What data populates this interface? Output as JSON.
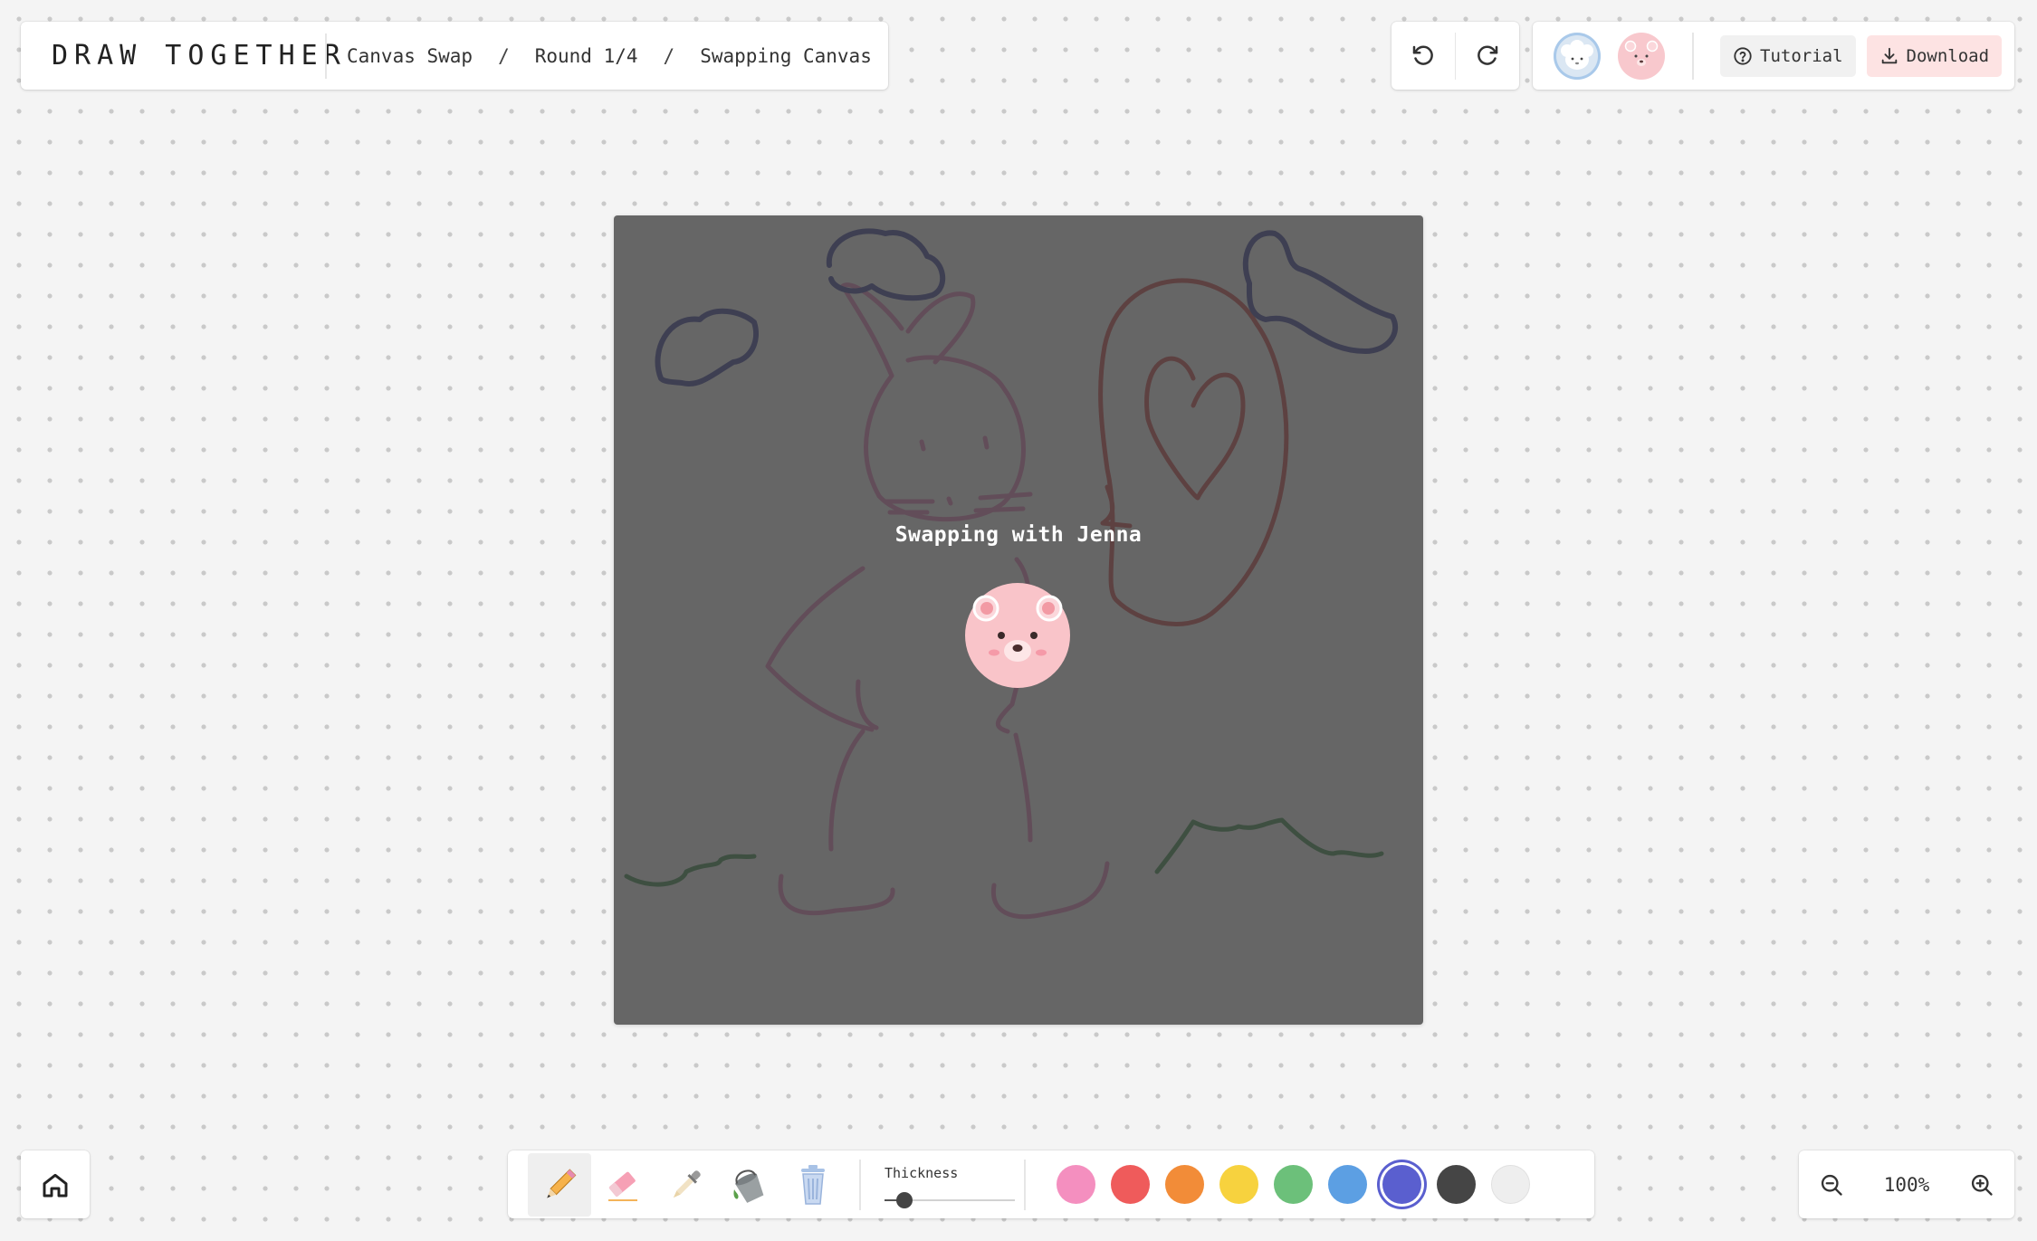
{
  "header": {
    "app_title": "DRAW TOGETHER",
    "breadcrumb": [
      "Canvas Swap",
      "Round 1/4",
      "Swapping Canvas"
    ],
    "breadcrumb_separator": "/"
  },
  "history": {
    "undo_icon": "undo-icon",
    "redo_icon": "redo-icon"
  },
  "players": [
    {
      "icon": "sheep-avatar-icon",
      "color": "#dbe7f3"
    },
    {
      "icon": "bear-avatar-icon",
      "color": "#f8c8cd"
    }
  ],
  "actions": {
    "tutorial_label": "Tutorial",
    "download_label": "Download"
  },
  "canvas": {
    "overlay_text": "Swapping with Jenna",
    "overlay_avatar_icon": "bear-avatar-icon"
  },
  "toolbar": {
    "tools": [
      {
        "name": "pencil",
        "icon": "pencil-icon",
        "active": true
      },
      {
        "name": "eraser",
        "icon": "eraser-icon",
        "active": false
      },
      {
        "name": "eyedropper",
        "icon": "eyedropper-icon",
        "active": false
      },
      {
        "name": "fill",
        "icon": "paint-bucket-icon",
        "active": false
      },
      {
        "name": "clear",
        "icon": "trash-icon",
        "active": false
      }
    ],
    "thickness_label": "Thickness",
    "thickness_level": 0.15,
    "colors": [
      "#f48fbf",
      "#ef5b5b",
      "#f28c38",
      "#f7d23e",
      "#6cc07a",
      "#5c9fe3",
      "#5a5fcf",
      "#454545",
      "#eeeeee"
    ],
    "selected_color": "#5a5fcf"
  },
  "zoom": {
    "level": "100%"
  },
  "home": {
    "icon": "home-icon"
  }
}
